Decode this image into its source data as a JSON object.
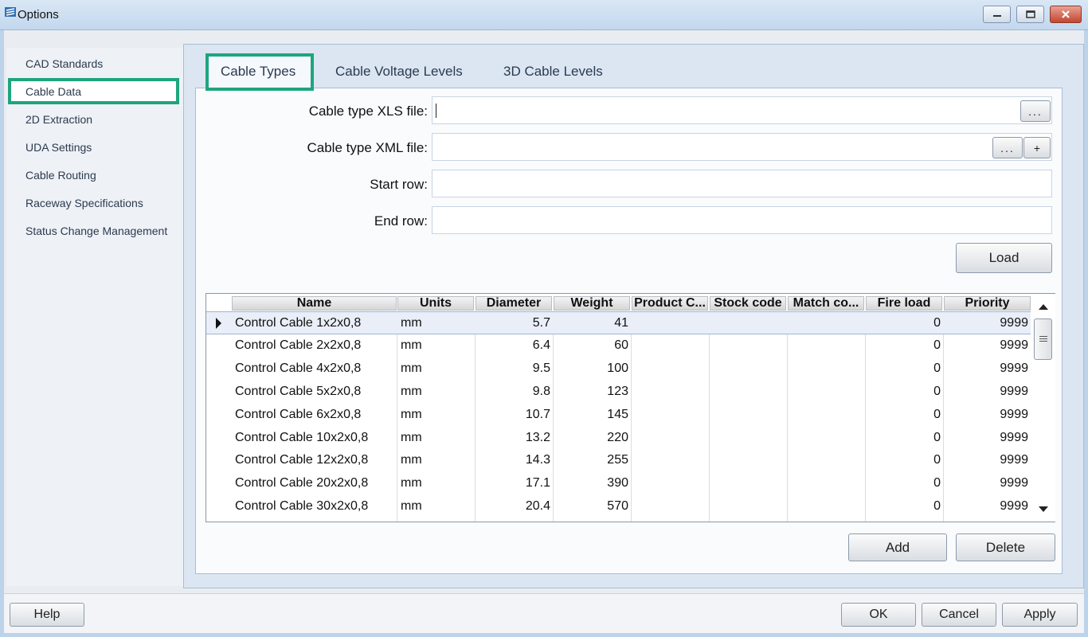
{
  "window": {
    "title": "Options"
  },
  "nav": {
    "items": [
      {
        "label": "CAD Standards"
      },
      {
        "label": "Cable Data"
      },
      {
        "label": "2D Extraction"
      },
      {
        "label": "UDA Settings"
      },
      {
        "label": "Cable Routing"
      },
      {
        "label": "Raceway Specifications"
      },
      {
        "label": "Status Change Management"
      }
    ],
    "selected": "Cable Data"
  },
  "tabs": [
    {
      "label": "Cable Types"
    },
    {
      "label": "Cable Voltage Levels"
    },
    {
      "label": "3D Cable Levels"
    }
  ],
  "active_tab": "Cable Types",
  "form": {
    "xls_label": "Cable type XLS file:",
    "xls_value": "",
    "xml_label": "Cable type XML file:",
    "xml_value": "",
    "browse_label": "...",
    "plus_label": "+",
    "start_label": "Start row:",
    "start_value": "",
    "end_label": "End row:",
    "end_value": "",
    "load_label": "Load"
  },
  "grid": {
    "columns": [
      "Name",
      "Units",
      "Diameter",
      "Weight",
      "Product C...",
      "Stock code",
      "Match co...",
      "Fire load",
      "Priority"
    ],
    "rows": [
      [
        "Control Cable 1x2x0,8",
        "mm",
        "5.7",
        "41",
        "",
        "",
        "",
        "0",
        "9999"
      ],
      [
        "Control Cable 2x2x0,8",
        "mm",
        "6.4",
        "60",
        "",
        "",
        "",
        "0",
        "9999"
      ],
      [
        "Control Cable 4x2x0,8",
        "mm",
        "9.5",
        "100",
        "",
        "",
        "",
        "0",
        "9999"
      ],
      [
        "Control Cable 5x2x0,8",
        "mm",
        "9.8",
        "123",
        "",
        "",
        "",
        "0",
        "9999"
      ],
      [
        "Control Cable 6x2x0,8",
        "mm",
        "10.7",
        "145",
        "",
        "",
        "",
        "0",
        "9999"
      ],
      [
        "Control Cable 10x2x0,8",
        "mm",
        "13.2",
        "220",
        "",
        "",
        "",
        "0",
        "9999"
      ],
      [
        "Control Cable 12x2x0,8",
        "mm",
        "14.3",
        "255",
        "",
        "",
        "",
        "0",
        "9999"
      ],
      [
        "Control Cable 20x2x0,8",
        "mm",
        "17.1",
        "390",
        "",
        "",
        "",
        "0",
        "9999"
      ],
      [
        "Control Cable 30x2x0,8",
        "mm",
        "20.4",
        "570",
        "",
        "",
        "",
        "0",
        "9999"
      ]
    ],
    "selected_row": 0
  },
  "actions": {
    "add_label": "Add",
    "delete_label": "Delete"
  },
  "footer": {
    "help_label": "Help",
    "ok_label": "OK",
    "cancel_label": "Cancel",
    "apply_label": "Apply"
  },
  "colors": {
    "highlight": "#1fa57e"
  }
}
